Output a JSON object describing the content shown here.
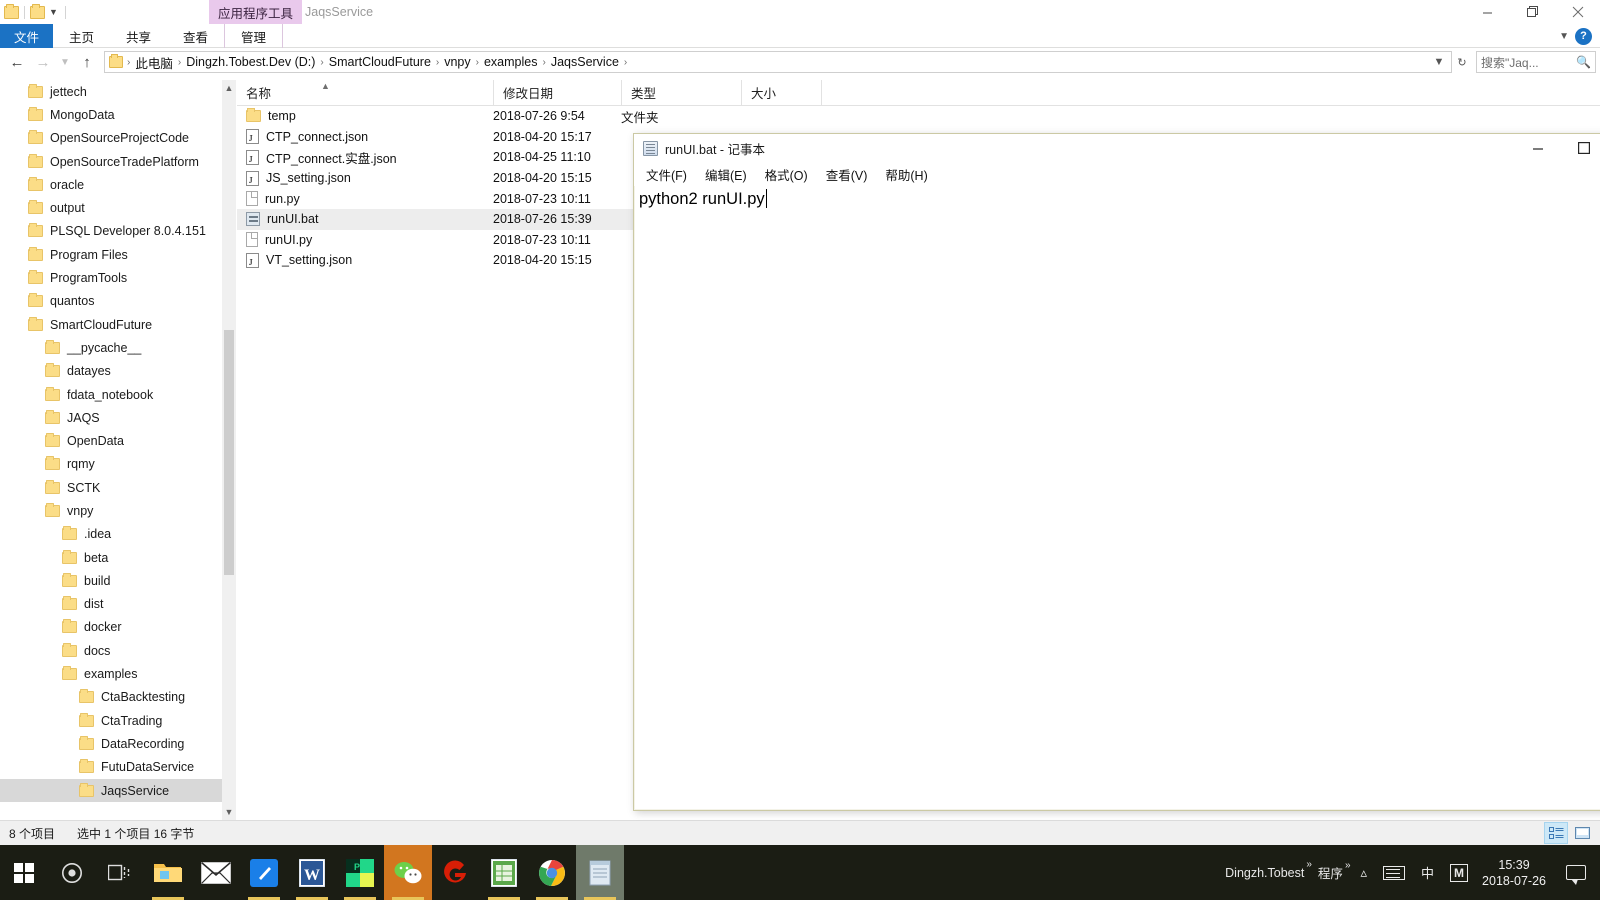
{
  "explorer": {
    "quick_access": {
      "folder_icon": "folder-icon",
      "dropdown_icon": "chevron-down-icon"
    },
    "contextual_tab_group": "应用程序工具",
    "window_title": "JaqsService",
    "window_buttons": {
      "minimize": "minimize-icon",
      "maximize": "restore-icon",
      "close": "close-icon"
    },
    "ribbon": {
      "tabs": [
        {
          "label": "文件",
          "type": "file"
        },
        {
          "label": "主页",
          "type": "normal"
        },
        {
          "label": "共享",
          "type": "normal"
        },
        {
          "label": "查看",
          "type": "normal"
        },
        {
          "label": "管理",
          "type": "contextual"
        }
      ],
      "collapse_icon": "chevron-down-icon",
      "help_label": "?"
    },
    "address_bar": {
      "back_icon": "arrow-left-icon",
      "forward_icon": "arrow-right-icon",
      "recent_icon": "chevron-down-icon",
      "up_icon": "arrow-up-icon",
      "crumbs": [
        "此电脑",
        "Dingzh.Tobest.Dev (D:)",
        "SmartCloudFuture",
        "vnpy",
        "examples",
        "JaqsService"
      ],
      "separator": "›",
      "dropdown_icon": "chevron-down-icon",
      "refresh_icon": "refresh-icon",
      "search_placeholder": "搜索\"Jaq...",
      "search_icon": "search-icon"
    },
    "nav_pane": {
      "items": [
        {
          "label": "jettech",
          "indent": 1
        },
        {
          "label": "MongoData",
          "indent": 1
        },
        {
          "label": "OpenSourceProjectCode",
          "indent": 1
        },
        {
          "label": "OpenSourceTradePlatform",
          "indent": 1
        },
        {
          "label": "oracle",
          "indent": 1
        },
        {
          "label": "output",
          "indent": 1
        },
        {
          "label": "PLSQL Developer 8.0.4.151",
          "indent": 1
        },
        {
          "label": "Program Files",
          "indent": 1
        },
        {
          "label": "ProgramTools",
          "indent": 1
        },
        {
          "label": "quantos",
          "indent": 1
        },
        {
          "label": "SmartCloudFuture",
          "indent": 1
        },
        {
          "label": "__pycache__",
          "indent": 2
        },
        {
          "label": "datayes",
          "indent": 2
        },
        {
          "label": "fdata_notebook",
          "indent": 2
        },
        {
          "label": "JAQS",
          "indent": 2
        },
        {
          "label": "OpenData",
          "indent": 2
        },
        {
          "label": "rqmy",
          "indent": 2
        },
        {
          "label": "SCTK",
          "indent": 2
        },
        {
          "label": "vnpy",
          "indent": 2
        },
        {
          "label": ".idea",
          "indent": 3
        },
        {
          "label": "beta",
          "indent": 3
        },
        {
          "label": "build",
          "indent": 3
        },
        {
          "label": "dist",
          "indent": 3
        },
        {
          "label": "docker",
          "indent": 3
        },
        {
          "label": "docs",
          "indent": 3
        },
        {
          "label": "examples",
          "indent": 3
        },
        {
          "label": "CtaBacktesting",
          "indent": 4
        },
        {
          "label": "CtaTrading",
          "indent": 4
        },
        {
          "label": "DataRecording",
          "indent": 4
        },
        {
          "label": "FutuDataService",
          "indent": 4
        },
        {
          "label": "JaqsService",
          "indent": 4,
          "selected": true
        }
      ],
      "scroll_up_icon": "chevron-up-icon",
      "scroll_down_icon": "chevron-down-icon"
    },
    "file_list": {
      "columns": [
        {
          "label": "名称",
          "key": "name"
        },
        {
          "label": "修改日期",
          "key": "date"
        },
        {
          "label": "类型",
          "key": "type"
        },
        {
          "label": "大小",
          "key": "size"
        }
      ],
      "sort_indicator": "sort-ascending-icon",
      "rows": [
        {
          "name": "temp",
          "date": "2018-07-26 9:54",
          "type": "文件夹",
          "size": "",
          "icon": "folder"
        },
        {
          "name": "CTP_connect.json",
          "date": "2018-04-20 15:17",
          "type": "",
          "size": "",
          "icon": "json"
        },
        {
          "name": "CTP_connect.实盘.json",
          "date": "2018-04-25 11:10",
          "type": "",
          "size": "",
          "icon": "json"
        },
        {
          "name": "JS_setting.json",
          "date": "2018-04-20 15:15",
          "type": "",
          "size": "",
          "icon": "json"
        },
        {
          "name": "run.py",
          "date": "2018-07-23 10:11",
          "type": "",
          "size": "",
          "icon": "doc"
        },
        {
          "name": "runUI.bat",
          "date": "2018-07-26 15:39",
          "type": "",
          "size": "",
          "icon": "bat",
          "selected": true
        },
        {
          "name": "runUI.py",
          "date": "2018-07-23 10:11",
          "type": "",
          "size": "",
          "icon": "doc"
        },
        {
          "name": "VT_setting.json",
          "date": "2018-04-20 15:15",
          "type": "",
          "size": "",
          "icon": "json"
        }
      ]
    },
    "status_bar": {
      "item_count": "8 个项目",
      "selection": "选中 1 个项目  16 字节",
      "view_details_icon": "details-view-icon",
      "view_large_icon": "large-icons-view-icon"
    }
  },
  "notepad": {
    "title": "runUI.bat - 记事本",
    "icon": "notepad-icon",
    "menu": [
      "文件(F)",
      "编辑(E)",
      "格式(O)",
      "查看(V)",
      "帮助(H)"
    ],
    "content": "python2 runUI.py",
    "window_buttons": {
      "minimize": "minimize-icon",
      "maximize": "maximize-icon"
    }
  },
  "taskbar": {
    "start_icon": "windows-start-icon",
    "search_icon": "cortana-circle-icon",
    "taskview_icon": "task-view-icon",
    "items": [
      {
        "name": "file-explorer-icon",
        "running": true
      },
      {
        "name": "mail-icon",
        "running": false
      },
      {
        "name": "editor-icon",
        "running": true
      },
      {
        "name": "word-icon",
        "running": true
      },
      {
        "name": "pycharm-icon",
        "running": true
      },
      {
        "name": "wechat-icon",
        "running": true,
        "active": true
      },
      {
        "name": "gitee-icon",
        "running": false
      },
      {
        "name": "excel-icon",
        "running": true
      },
      {
        "name": "chrome-icon",
        "running": true
      },
      {
        "name": "notepad-icon",
        "running": true,
        "highlight": true
      }
    ],
    "tray": {
      "user_label": "Dingzh.Tobest",
      "programs_label": "程序",
      "overflow_icon": "chevron-up-icon",
      "keyboard_icon": "keyboard-icon",
      "ime_label": "中",
      "ime_mode": "M",
      "time": "15:39",
      "date": "2018-07-26",
      "action_center_icon": "notification-icon"
    }
  }
}
